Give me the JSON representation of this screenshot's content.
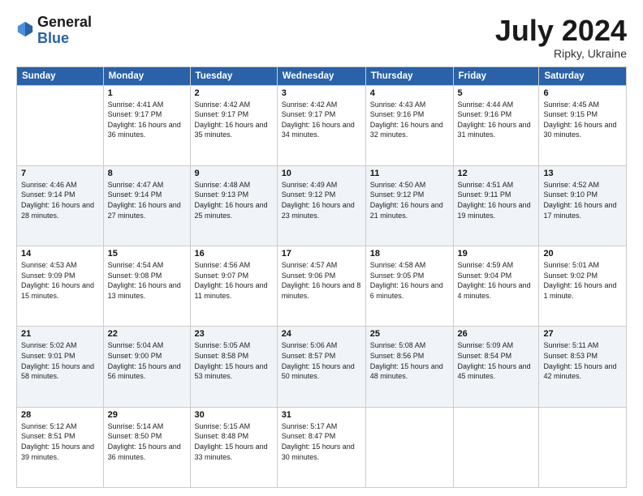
{
  "header": {
    "logo_general": "General",
    "logo_blue": "Blue",
    "month_year": "July 2024",
    "location": "Ripky, Ukraine"
  },
  "weekdays": [
    "Sunday",
    "Monday",
    "Tuesday",
    "Wednesday",
    "Thursday",
    "Friday",
    "Saturday"
  ],
  "weeks": [
    [
      {
        "day": null
      },
      {
        "day": "1",
        "sunrise": "4:41 AM",
        "sunset": "9:17 PM",
        "daylight": "16 hours and 36 minutes."
      },
      {
        "day": "2",
        "sunrise": "4:42 AM",
        "sunset": "9:17 PM",
        "daylight": "16 hours and 35 minutes."
      },
      {
        "day": "3",
        "sunrise": "4:42 AM",
        "sunset": "9:17 PM",
        "daylight": "16 hours and 34 minutes."
      },
      {
        "day": "4",
        "sunrise": "4:43 AM",
        "sunset": "9:16 PM",
        "daylight": "16 hours and 32 minutes."
      },
      {
        "day": "5",
        "sunrise": "4:44 AM",
        "sunset": "9:16 PM",
        "daylight": "16 hours and 31 minutes."
      },
      {
        "day": "6",
        "sunrise": "4:45 AM",
        "sunset": "9:15 PM",
        "daylight": "16 hours and 30 minutes."
      }
    ],
    [
      {
        "day": "7",
        "sunrise": "4:46 AM",
        "sunset": "9:14 PM",
        "daylight": "16 hours and 28 minutes."
      },
      {
        "day": "8",
        "sunrise": "4:47 AM",
        "sunset": "9:14 PM",
        "daylight": "16 hours and 27 minutes."
      },
      {
        "day": "9",
        "sunrise": "4:48 AM",
        "sunset": "9:13 PM",
        "daylight": "16 hours and 25 minutes."
      },
      {
        "day": "10",
        "sunrise": "4:49 AM",
        "sunset": "9:12 PM",
        "daylight": "16 hours and 23 minutes."
      },
      {
        "day": "11",
        "sunrise": "4:50 AM",
        "sunset": "9:12 PM",
        "daylight": "16 hours and 21 minutes."
      },
      {
        "day": "12",
        "sunrise": "4:51 AM",
        "sunset": "9:11 PM",
        "daylight": "16 hours and 19 minutes."
      },
      {
        "day": "13",
        "sunrise": "4:52 AM",
        "sunset": "9:10 PM",
        "daylight": "16 hours and 17 minutes."
      }
    ],
    [
      {
        "day": "14",
        "sunrise": "4:53 AM",
        "sunset": "9:09 PM",
        "daylight": "16 hours and 15 minutes."
      },
      {
        "day": "15",
        "sunrise": "4:54 AM",
        "sunset": "9:08 PM",
        "daylight": "16 hours and 13 minutes."
      },
      {
        "day": "16",
        "sunrise": "4:56 AM",
        "sunset": "9:07 PM",
        "daylight": "16 hours and 11 minutes."
      },
      {
        "day": "17",
        "sunrise": "4:57 AM",
        "sunset": "9:06 PM",
        "daylight": "16 hours and 8 minutes."
      },
      {
        "day": "18",
        "sunrise": "4:58 AM",
        "sunset": "9:05 PM",
        "daylight": "16 hours and 6 minutes."
      },
      {
        "day": "19",
        "sunrise": "4:59 AM",
        "sunset": "9:04 PM",
        "daylight": "16 hours and 4 minutes."
      },
      {
        "day": "20",
        "sunrise": "5:01 AM",
        "sunset": "9:02 PM",
        "daylight": "16 hours and 1 minute."
      }
    ],
    [
      {
        "day": "21",
        "sunrise": "5:02 AM",
        "sunset": "9:01 PM",
        "daylight": "15 hours and 58 minutes."
      },
      {
        "day": "22",
        "sunrise": "5:04 AM",
        "sunset": "9:00 PM",
        "daylight": "15 hours and 56 minutes."
      },
      {
        "day": "23",
        "sunrise": "5:05 AM",
        "sunset": "8:58 PM",
        "daylight": "15 hours and 53 minutes."
      },
      {
        "day": "24",
        "sunrise": "5:06 AM",
        "sunset": "8:57 PM",
        "daylight": "15 hours and 50 minutes."
      },
      {
        "day": "25",
        "sunrise": "5:08 AM",
        "sunset": "8:56 PM",
        "daylight": "15 hours and 48 minutes."
      },
      {
        "day": "26",
        "sunrise": "5:09 AM",
        "sunset": "8:54 PM",
        "daylight": "15 hours and 45 minutes."
      },
      {
        "day": "27",
        "sunrise": "5:11 AM",
        "sunset": "8:53 PM",
        "daylight": "15 hours and 42 minutes."
      }
    ],
    [
      {
        "day": "28",
        "sunrise": "5:12 AM",
        "sunset": "8:51 PM",
        "daylight": "15 hours and 39 minutes."
      },
      {
        "day": "29",
        "sunrise": "5:14 AM",
        "sunset": "8:50 PM",
        "daylight": "15 hours and 36 minutes."
      },
      {
        "day": "30",
        "sunrise": "5:15 AM",
        "sunset": "8:48 PM",
        "daylight": "15 hours and 33 minutes."
      },
      {
        "day": "31",
        "sunrise": "5:17 AM",
        "sunset": "8:47 PM",
        "daylight": "15 hours and 30 minutes."
      },
      {
        "day": null
      },
      {
        "day": null
      },
      {
        "day": null
      }
    ]
  ]
}
